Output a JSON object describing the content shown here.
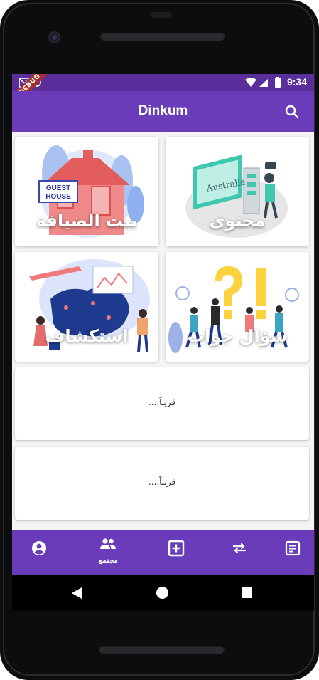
{
  "status": {
    "time": "9:34",
    "debug_label": "DEBUG"
  },
  "appbar": {
    "title": "Dinkum",
    "search_icon": "search-icon"
  },
  "grid": {
    "cards": [
      {
        "label": "بيت الضيافة",
        "sign": "GUEST HOUSE"
      },
      {
        "label": "محتوى",
        "sign": "Australia"
      },
      {
        "label": "استكشاف"
      },
      {
        "label": "سؤال جواب"
      }
    ]
  },
  "wide_cards": [
    {
      "text": "قريباً...."
    },
    {
      "text": "قريباً...."
    }
  ],
  "bottom_nav": {
    "items": [
      {
        "icon": "account-circle-icon"
      },
      {
        "icon": "people-icon",
        "label": "مجتمع",
        "active": true
      },
      {
        "icon": "add-box-icon"
      },
      {
        "icon": "swap-arrows-icon"
      },
      {
        "icon": "article-icon"
      }
    ]
  },
  "colors": {
    "status_bar": "#5a2f9c",
    "app_bar": "#6a3cba",
    "debug_banner": "#a0322b"
  }
}
